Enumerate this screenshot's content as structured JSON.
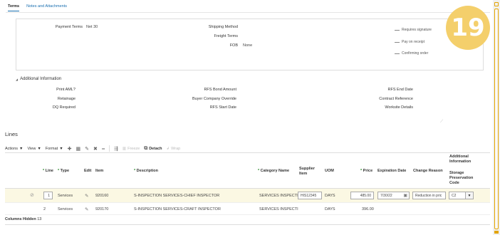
{
  "tabs": [
    {
      "label": "Terms"
    },
    {
      "label": "Notes and Attachments"
    }
  ],
  "terms": {
    "payment_terms_label": "Payment Terms",
    "payment_terms_value": "Net 30",
    "shipping_method_label": "Shipping Method",
    "freight_terms_label": "Freight Terms",
    "fob_label": "FOB",
    "fob_value": "None",
    "checks": [
      "Requires signature",
      "Pay on receipt",
      "Confirming order"
    ]
  },
  "badge": "19",
  "additional_info": {
    "title": "Additional Information",
    "fields": {
      "print_aml": "Print AML?",
      "retainage": "Retainage",
      "dq_required": "DQ Required",
      "rfs_bond_amount": "RFS Bond Amount",
      "buyer_company_override": "Buyer Company Override",
      "rfs_start_date": "RFS Start Date",
      "rfs_end_date": "RFS End Date",
      "contract_reference": "Contract Reference",
      "worksite_details": "Worksite Details"
    }
  },
  "lines": {
    "title": "Lines",
    "toolbar": {
      "actions": "Actions",
      "view": "View",
      "format": "Format",
      "freeze": "Freeze",
      "detach": "Detach",
      "wrap": "Wrap"
    },
    "columns": {
      "line": "Line",
      "type": "Type",
      "edit": "Edit",
      "item": "Item",
      "description": "Description",
      "category_name": "Category Name",
      "supplier_item_1": "Supplier",
      "supplier_item_2": "Item",
      "uom": "UOM",
      "price": "Price",
      "expiration_date": "Expiration Date",
      "change_reason": "Change Reason",
      "additional_information_1": "Additional",
      "additional_information_2": "Information",
      "storage_1": "Storage",
      "storage_2": "Preservation",
      "storage_3": "Code"
    },
    "rows": [
      {
        "line": "1",
        "type": "Services",
        "item": "920160",
        "description": "S-INSPECTION SERVICES-CHIEF INSPECTOR",
        "category": "SERVICES INSPECTI",
        "supplier_item": "HIS12345",
        "uom": "DAYS",
        "price": "485.00",
        "expiration": "7/30/22",
        "change_reason": "Reduction in pric",
        "storage": "C2"
      },
      {
        "line": "2",
        "type": "Services",
        "item": "920170",
        "description": "S-INSPECTION SERVICES-CRAFT INSPECTOR",
        "category": "SERVICES INSPECTI",
        "supplier_item": "",
        "uom": "DAYS",
        "price": "396.00"
      }
    ],
    "footer_label": "Columns Hidden",
    "footer_value": "13"
  },
  "colors": {
    "accent": "#1a6fb0",
    "badge": "#f4cf6b",
    "scroll": "#e3a400",
    "selected_row": "#fbf8e3"
  }
}
